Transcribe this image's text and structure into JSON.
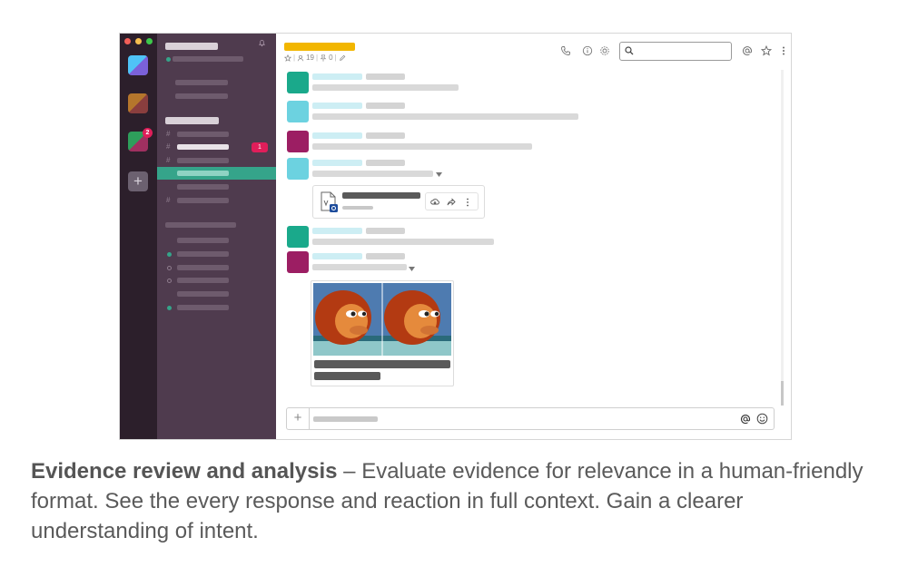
{
  "window": {
    "traffic_lights": [
      "#f25f58",
      "#f6be4f",
      "#3dc94b"
    ]
  },
  "workspaces": {
    "tiles": [
      {
        "name": "workspace-1",
        "colors": [
          "#4fc3f7",
          "#7b61d9"
        ]
      },
      {
        "name": "workspace-2",
        "colors": [
          "#b5762c",
          "#8a3e3e"
        ]
      },
      {
        "name": "workspace-3",
        "colors": [
          "#2e9e5b",
          "#a03060"
        ],
        "badge": "2"
      }
    ],
    "add_label": "+"
  },
  "sidebar": {
    "unread_badge": "1",
    "hash_symbol": "#",
    "accent": "#35a48a"
  },
  "channel": {
    "meta_members": "19",
    "meta_pins": "0",
    "title_color": "#f2b600"
  },
  "header_icons": [
    "phone-icon",
    "info-icon",
    "gear-icon",
    "search-icon",
    "at-icon",
    "star-icon",
    "more-icon"
  ],
  "messages": [
    {
      "avatar_color": "#1aa98b"
    },
    {
      "avatar_color": "#6cd2e0"
    },
    {
      "avatar_color": "#9c1e63"
    },
    {
      "avatar_color": "#6cd2e0"
    },
    {
      "avatar_color": "#1aa98b"
    },
    {
      "avatar_color": "#9c1e63"
    }
  ],
  "composer": {
    "plus_label": "+"
  },
  "caption": {
    "bold": "Evidence review and analysis",
    "text": " – Evaluate evidence for relevance in a human-friendly format. See the every response and reaction in full context. Gain a clearer understanding of intent."
  }
}
